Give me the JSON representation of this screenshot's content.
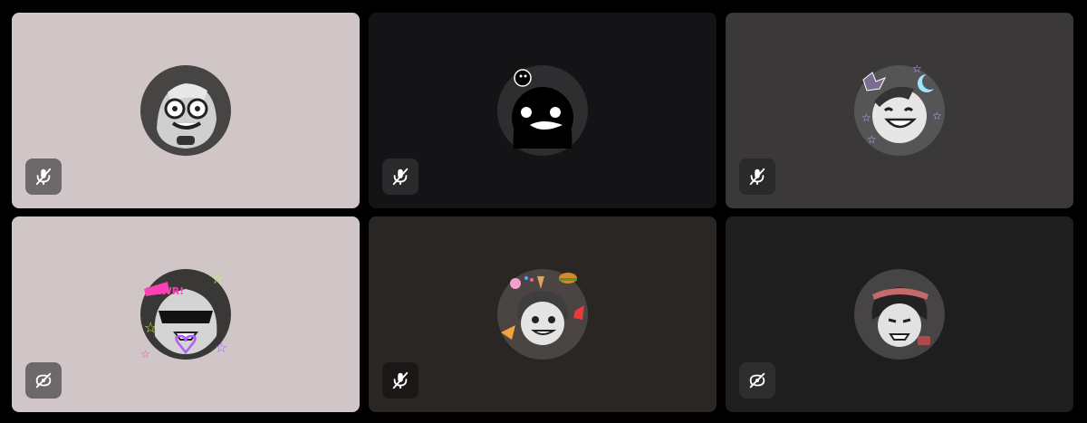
{
  "colors": {
    "page_background": "#000000",
    "status_icon": "#ffffff"
  },
  "tiles": [
    {
      "background": "#d0c6c7",
      "status": "muted-microphone",
      "status_bg": "#6d6869"
    },
    {
      "background": "#141416",
      "status": "muted-microphone",
      "status_bg": "#2a2a2c"
    },
    {
      "background": "#3a3838",
      "status": "muted-microphone",
      "status_bg": "#2b2a2a"
    },
    {
      "background": "#d0c6c7",
      "status": "camera-off",
      "status_bg": "#6d6869"
    },
    {
      "background": "#2a2624",
      "status": "muted-microphone",
      "status_bg": "#1a1716"
    },
    {
      "background": "#1f1e1f",
      "status": "camera-off",
      "status_bg": "#2f2e2f"
    }
  ]
}
